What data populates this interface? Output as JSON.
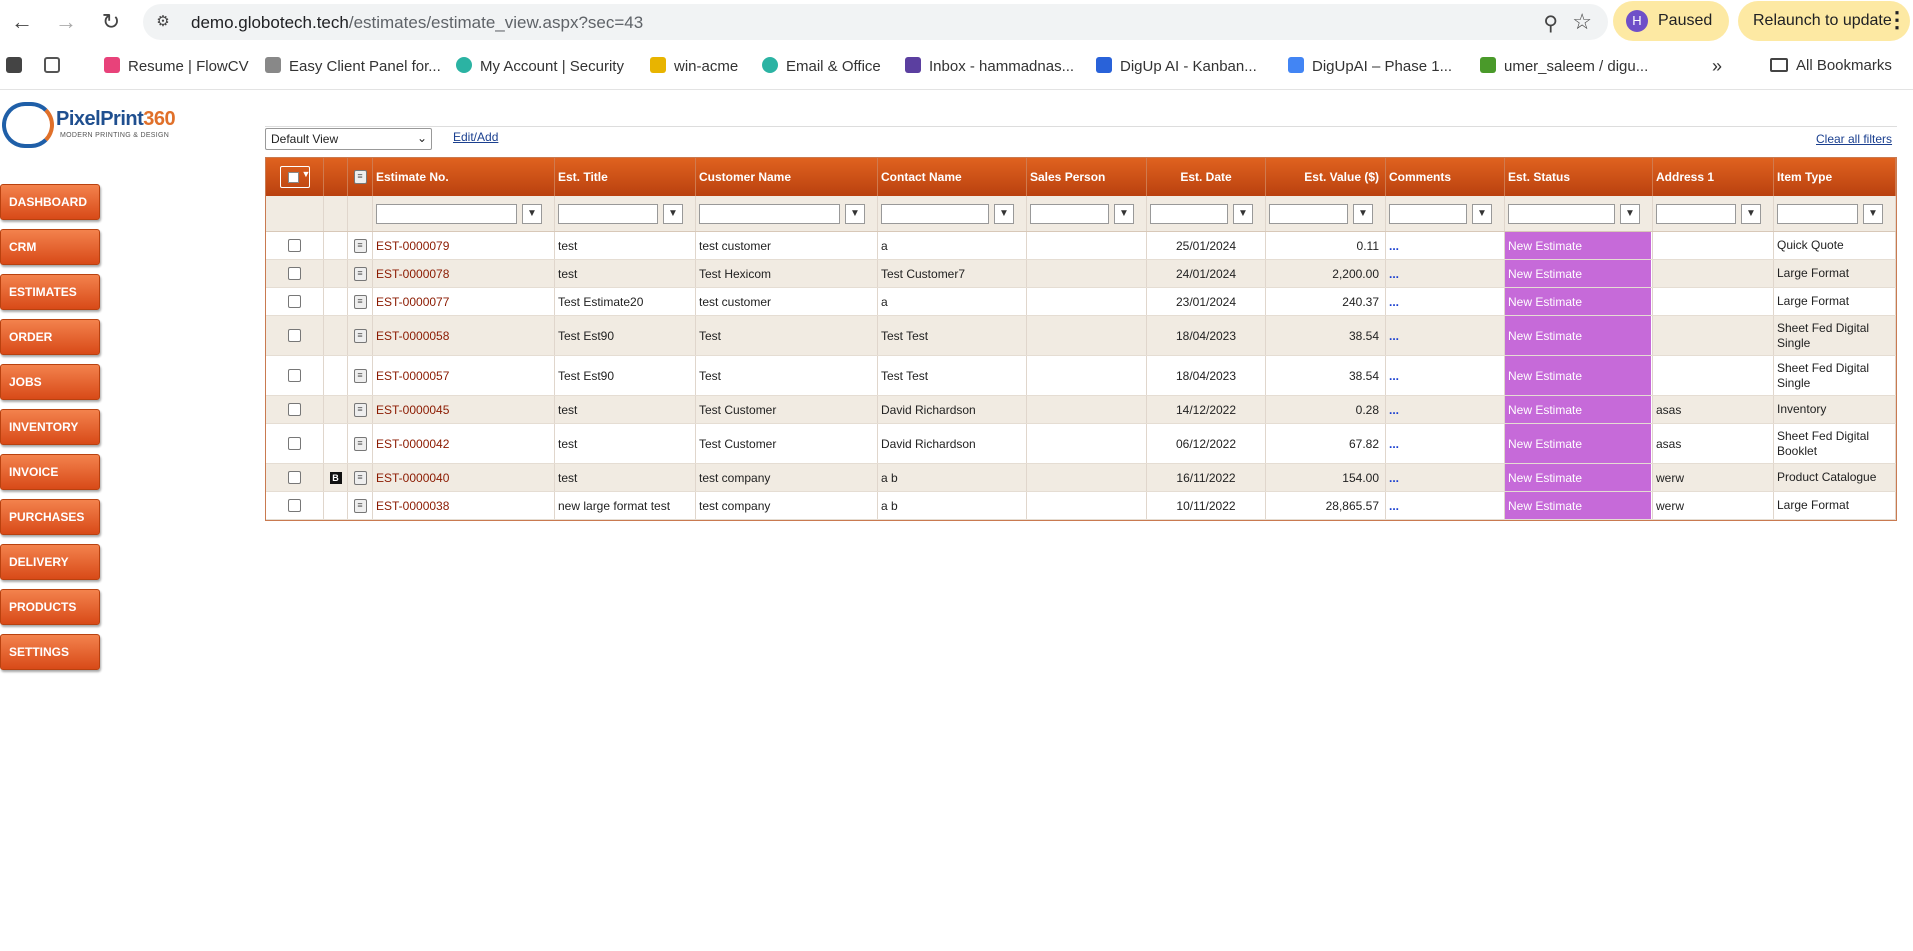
{
  "browser": {
    "url_domain": "demo.globotech.tech",
    "url_path": "/estimates/estimate_view.aspx?sec=43",
    "profile_initial": "H",
    "profile_status": "Paused",
    "relaunch_label": "Relaunch to update",
    "bookmarks": [
      {
        "label": "Resume | FlowCV",
        "color": "#e8427a"
      },
      {
        "label": "Easy Client Panel for...",
        "color": "#888888"
      },
      {
        "label": "My Account | Security",
        "color": "#2bb3a3"
      },
      {
        "label": "win-acme",
        "color": "#e8b400"
      },
      {
        "label": "Email & Office",
        "color": "#2bb3a3"
      },
      {
        "label": "Inbox - hammadnas...",
        "color": "#5b3fa0"
      },
      {
        "label": "DigUp AI - Kanban...",
        "color": "#2962d9"
      },
      {
        "label": "DigUpAI – Phase 1...",
        "color": "#4285f4"
      },
      {
        "label": "umer_saleem / digu...",
        "color": "#4a9a2a"
      }
    ],
    "all_bookmarks_label": "All Bookmarks"
  },
  "logo": {
    "name_a": "PixelPrint",
    "name_b": "360",
    "tagline": "MODERN PRINTING & DESIGN"
  },
  "sidebar": {
    "items": [
      "DASHBOARD",
      "CRM",
      "ESTIMATES",
      "ORDER",
      "JOBS",
      "INVENTORY",
      "INVOICE",
      "PURCHASES",
      "DELIVERY",
      "PRODUCTS",
      "SETTINGS"
    ]
  },
  "toolbar": {
    "view_select": "Default View",
    "edit_add": "Edit/Add",
    "clear_filters": "Clear all filters"
  },
  "grid": {
    "columns": [
      "Estimate No.",
      "Est. Title",
      "Customer Name",
      "Contact Name",
      "Sales Person",
      "Est. Date",
      "Est. Value ($)",
      "Comments",
      "Est. Status",
      "Address 1",
      "Item Type"
    ],
    "rows": [
      {
        "badge": "",
        "no": "EST-0000079",
        "title": "test",
        "customer": "test customer",
        "contact": "a",
        "sales": "",
        "date": "25/01/2024",
        "value": "0.11",
        "comments": "...",
        "status": "New Estimate",
        "address": "",
        "item": "Quick Quote"
      },
      {
        "badge": "",
        "no": "EST-0000078",
        "title": "test",
        "customer": "Test Hexicom",
        "contact": "Test Customer7",
        "sales": "",
        "date": "24/01/2024",
        "value": "2,200.00",
        "comments": "...",
        "status": "New Estimate",
        "address": "",
        "item": "Large Format"
      },
      {
        "badge": "",
        "no": "EST-0000077",
        "title": "Test Estimate20",
        "customer": "test customer",
        "contact": "a",
        "sales": "",
        "date": "23/01/2024",
        "value": "240.37",
        "comments": "...",
        "status": "New Estimate",
        "address": "",
        "item": "Large Format"
      },
      {
        "badge": "",
        "no": "EST-0000058",
        "title": "Test Est90",
        "customer": "Test",
        "contact": "Test Test",
        "sales": "",
        "date": "18/04/2023",
        "value": "38.54",
        "comments": "...",
        "status": "New Estimate",
        "address": "",
        "item": "Sheet Fed Digital Single"
      },
      {
        "badge": "",
        "no": "EST-0000057",
        "title": "Test Est90",
        "customer": "Test",
        "contact": "Test Test",
        "sales": "",
        "date": "18/04/2023",
        "value": "38.54",
        "comments": "...",
        "status": "New Estimate",
        "address": "",
        "item": "Sheet Fed Digital Single"
      },
      {
        "badge": "",
        "no": "EST-0000045",
        "title": "test",
        "customer": "Test Customer",
        "contact": "David Richardson",
        "sales": "",
        "date": "14/12/2022",
        "value": "0.28",
        "comments": "...",
        "status": "New Estimate",
        "address": "asas",
        "item": "Inventory"
      },
      {
        "badge": "",
        "no": "EST-0000042",
        "title": "test",
        "customer": "Test Customer",
        "contact": "David Richardson",
        "sales": "",
        "date": "06/12/2022",
        "value": "67.82",
        "comments": "...",
        "status": "New Estimate",
        "address": "asas",
        "item": "Sheet Fed Digital Booklet"
      },
      {
        "badge": "B",
        "no": "EST-0000040",
        "title": "test",
        "customer": "test company",
        "contact": "a b",
        "sales": "",
        "date": "16/11/2022",
        "value": "154.00",
        "comments": "...",
        "status": "New Estimate",
        "address": "werw",
        "item": "Product Catalogue"
      },
      {
        "badge": "",
        "no": "EST-0000038",
        "title": "new large format test",
        "customer": "test company",
        "contact": "a b",
        "sales": "",
        "date": "10/11/2022",
        "value": "28,865.57",
        "comments": "...",
        "status": "New Estimate",
        "address": "werw",
        "item": "Large Format"
      }
    ]
  },
  "colors": {
    "status_bg": "#c66ad9",
    "header_bg": "#d0501a",
    "link": "#8b1a00"
  }
}
